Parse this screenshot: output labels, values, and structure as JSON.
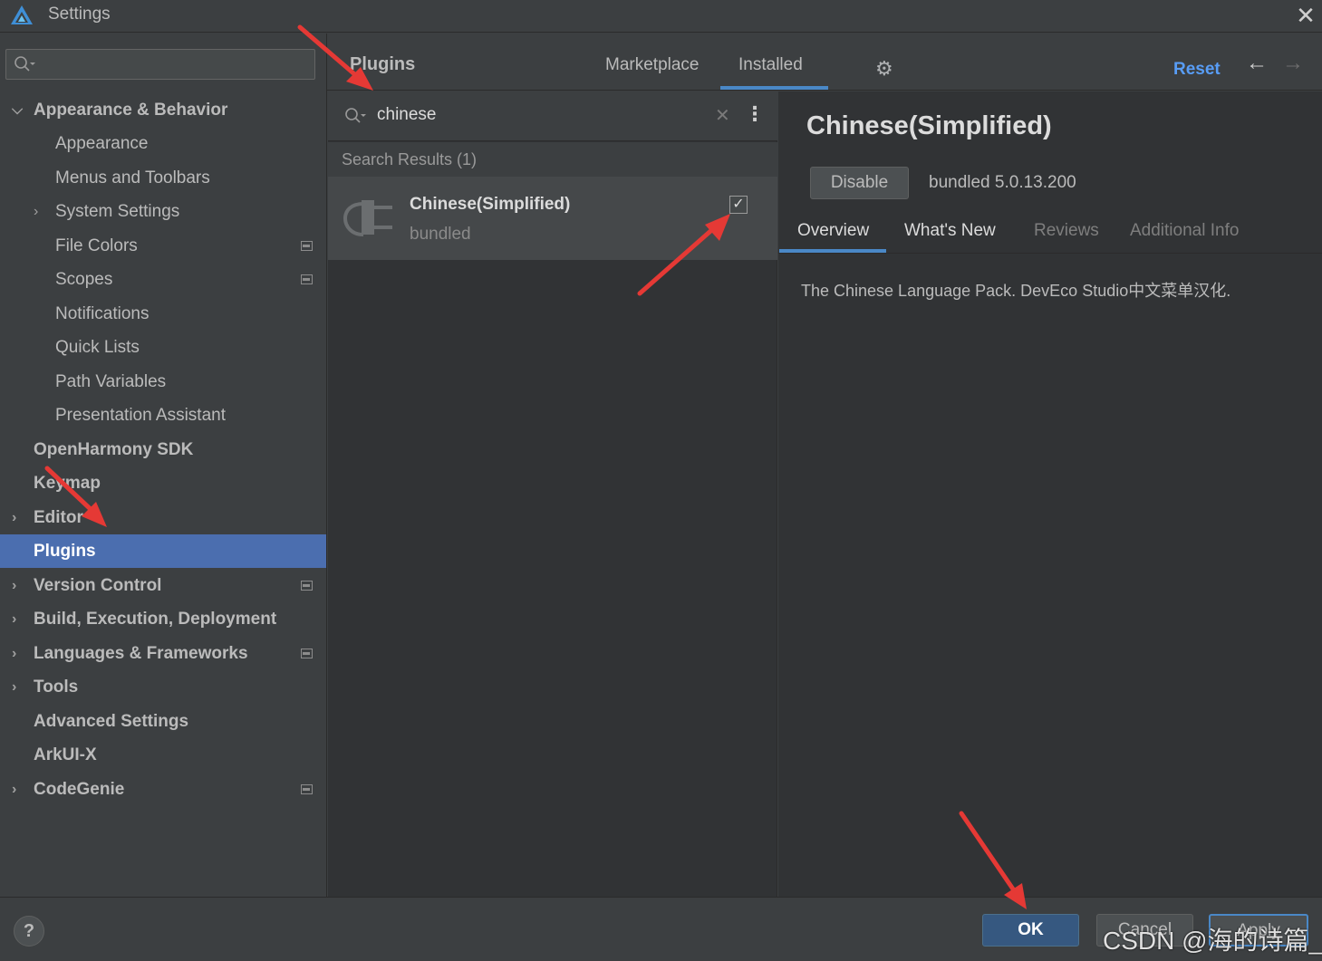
{
  "window": {
    "title": "Settings"
  },
  "sidebar": {
    "search_placeholder": "",
    "items": [
      {
        "label": "Appearance & Behavior",
        "bold": true,
        "expanded": true
      },
      {
        "label": "Appearance"
      },
      {
        "label": "Menus and Toolbars"
      },
      {
        "label": "System Settings"
      },
      {
        "label": "File Colors"
      },
      {
        "label": "Scopes"
      },
      {
        "label": "Notifications"
      },
      {
        "label": "Quick Lists"
      },
      {
        "label": "Path Variables"
      },
      {
        "label": "Presentation Assistant"
      },
      {
        "label": "OpenHarmony SDK",
        "bold": true
      },
      {
        "label": "Keymap",
        "bold": true
      },
      {
        "label": "Editor",
        "bold": true
      },
      {
        "label": "Plugins",
        "bold": true,
        "selected": true
      },
      {
        "label": "Version Control",
        "bold": true
      },
      {
        "label": "Build, Execution, Deployment",
        "bold": true
      },
      {
        "label": "Languages & Frameworks",
        "bold": true
      },
      {
        "label": "Tools",
        "bold": true
      },
      {
        "label": "Advanced Settings",
        "bold": true
      },
      {
        "label": "ArkUI-X",
        "bold": true
      },
      {
        "label": "CodeGenie",
        "bold": true
      }
    ]
  },
  "header": {
    "title": "Plugins",
    "tabs": [
      "Marketplace",
      "Installed"
    ],
    "active_tab": "Installed",
    "reset_label": "Reset"
  },
  "plugin_search": {
    "value": "chinese",
    "results_header": "Search Results (1)",
    "results": [
      {
        "name": "Chinese(Simplified)",
        "subtitle": "bundled",
        "enabled": true
      }
    ]
  },
  "detail": {
    "title": "Chinese(Simplified)",
    "disable_label": "Disable",
    "version": "bundled 5.0.13.200",
    "tabs": [
      "Overview",
      "What's New",
      "Reviews",
      "Additional Info"
    ],
    "active_tab": "Overview",
    "description": "The Chinese Language Pack. DevEco Studio中文菜单汉化."
  },
  "footer": {
    "help_label": "?",
    "ok_label": "OK",
    "cancel_label": "Cancel",
    "apply_label": "Apply",
    "watermark": "CSDN @海的诗篇_"
  },
  "colors": {
    "selection": "#4b6eaf",
    "accent": "#4a88c7",
    "link": "#589df6",
    "annotation_arrow": "#e53935"
  }
}
